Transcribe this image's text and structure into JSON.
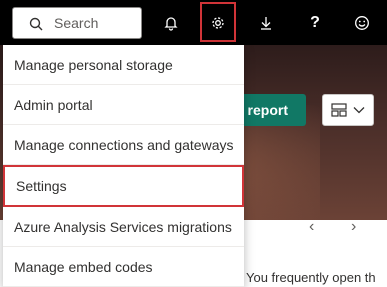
{
  "topbar": {
    "search": {
      "placeholder": "Search",
      "icon": "search-icon"
    },
    "icons": [
      "bell-icon",
      "gear-icon",
      "download-icon",
      "help-icon",
      "smiley-icon"
    ],
    "help_label": "?"
  },
  "background": {
    "report_button_label": "v report",
    "view_button_icon": "layout-icon",
    "bottom_text": "You frequently open th",
    "prev_icon": "‹",
    "next_icon": "›"
  },
  "settings_menu": {
    "items": [
      {
        "label": "Manage personal storage"
      },
      {
        "label": "Admin portal"
      },
      {
        "label": "Manage connections and gateways"
      },
      {
        "label": "Settings",
        "highlighted": true
      },
      {
        "label": "Azure Analysis Services migrations"
      },
      {
        "label": "Manage embed codes"
      }
    ]
  },
  "colors": {
    "highlight": "#d13438",
    "accent_green": "#117865"
  }
}
